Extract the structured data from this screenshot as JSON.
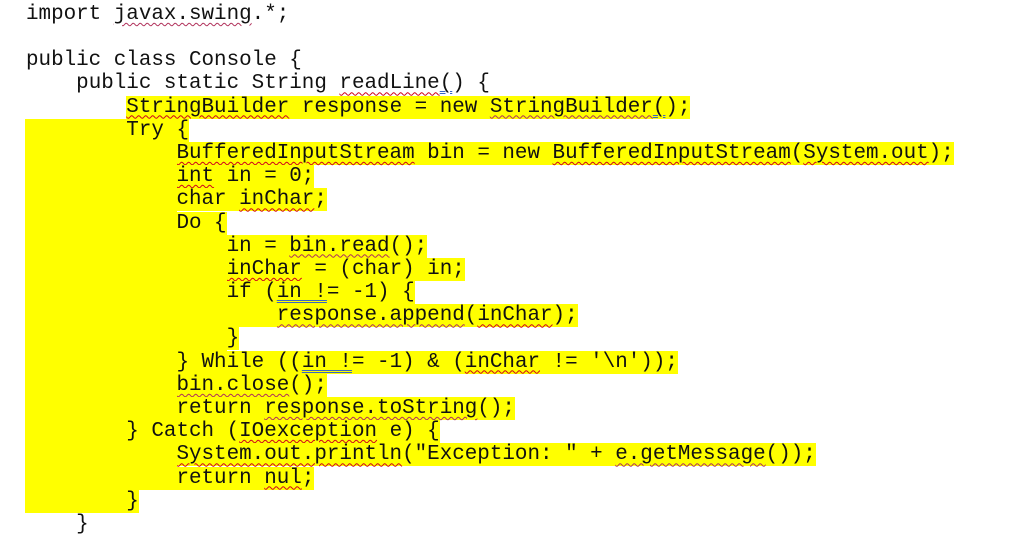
{
  "document": {
    "highlight_color": "#ffff00",
    "spell_underline_color": "#d0021b",
    "grammar_underline_color": "#3a66c4",
    "lines": [
      {
        "indent": 0,
        "hl": false,
        "fill": false,
        "segs": [
          {
            "t": "import "
          },
          {
            "t": "javax.swing",
            "u": "redblue"
          },
          {
            "t": ".*;"
          }
        ]
      },
      {
        "blank": true
      },
      {
        "indent": 0,
        "hl": false,
        "fill": false,
        "segs": [
          {
            "t": "public class Console {"
          }
        ]
      },
      {
        "indent": 4,
        "hl": false,
        "fill": false,
        "segs": [
          {
            "t": "public static String "
          },
          {
            "t": "readLine",
            "u": "red"
          },
          {
            "t": "(",
            "u": "blue"
          },
          {
            "t": ") {"
          }
        ]
      },
      {
        "indent": 8,
        "hl": true,
        "fill": false,
        "segs": [
          {
            "t": "StringBuilder",
            "u": "red"
          },
          {
            "t": " response = new "
          },
          {
            "t": "StringBuilder",
            "u": "redblue"
          },
          {
            "t": "(",
            "u": "blue"
          },
          {
            "t": ");"
          }
        ]
      },
      {
        "indent": 8,
        "hl": true,
        "fill": true,
        "segs": [
          {
            "t": "Try {"
          }
        ]
      },
      {
        "indent": 12,
        "hl": true,
        "fill": true,
        "segs": [
          {
            "t": "BufferedInputStream",
            "u": "red"
          },
          {
            "t": " bin = new "
          },
          {
            "t": "BufferedInputStream",
            "u": "red"
          },
          {
            "t": "("
          },
          {
            "t": "System.out",
            "u": "red"
          },
          {
            "t": ");"
          }
        ]
      },
      {
        "indent": 12,
        "hl": true,
        "fill": true,
        "segs": [
          {
            "t": "int",
            "u": "red"
          },
          {
            "t": " in = 0;"
          }
        ]
      },
      {
        "indent": 12,
        "hl": true,
        "fill": true,
        "segs": [
          {
            "t": "char "
          },
          {
            "t": "inChar",
            "u": "red"
          },
          {
            "t": ";"
          }
        ]
      },
      {
        "indent": 12,
        "hl": true,
        "fill": true,
        "segs": [
          {
            "t": "Do {"
          }
        ]
      },
      {
        "indent": 16,
        "hl": true,
        "fill": true,
        "segs": [
          {
            "t": "in = "
          },
          {
            "t": "bin.read",
            "u": "redblue"
          },
          {
            "t": "();"
          }
        ]
      },
      {
        "indent": 16,
        "hl": true,
        "fill": true,
        "segs": [
          {
            "t": "inChar",
            "u": "red"
          },
          {
            "t": " = (char) in;"
          }
        ]
      },
      {
        "indent": 16,
        "hl": true,
        "fill": true,
        "segs": [
          {
            "t": "if ("
          },
          {
            "t": "in !",
            "u": "blue"
          },
          {
            "t": "= -1) {"
          }
        ]
      },
      {
        "indent": 20,
        "hl": true,
        "fill": true,
        "segs": [
          {
            "t": "response.append",
            "u": "redblue"
          },
          {
            "t": "("
          },
          {
            "t": "inChar",
            "u": "red"
          },
          {
            "t": ");"
          }
        ]
      },
      {
        "indent": 16,
        "hl": true,
        "fill": true,
        "segs": [
          {
            "t": "}"
          }
        ]
      },
      {
        "indent": 12,
        "hl": true,
        "fill": true,
        "segs": [
          {
            "t": "} While (("
          },
          {
            "t": "in !",
            "u": "blue"
          },
          {
            "t": "= -1) & ("
          },
          {
            "t": "inChar",
            "u": "red"
          },
          {
            "t": " != '\\n'));"
          }
        ]
      },
      {
        "indent": 12,
        "hl": true,
        "fill": true,
        "segs": [
          {
            "t": "bin.close",
            "u": "redblue"
          },
          {
            "t": "();"
          }
        ]
      },
      {
        "indent": 12,
        "hl": true,
        "fill": true,
        "segs": [
          {
            "t": "return "
          },
          {
            "t": "response.toString",
            "u": "redblue"
          },
          {
            "t": "();"
          }
        ]
      },
      {
        "indent": 8,
        "hl": true,
        "fill": true,
        "segs": [
          {
            "t": "} Catch ("
          },
          {
            "t": "IOexception",
            "u": "red"
          },
          {
            "t": " e) {"
          }
        ]
      },
      {
        "indent": 12,
        "hl": true,
        "fill": true,
        "segs": [
          {
            "t": "System.out.println",
            "u": "red"
          },
          {
            "t": "(\"Exception: \" + "
          },
          {
            "t": "e.getMessage",
            "u": "redblue"
          },
          {
            "t": "());"
          }
        ]
      },
      {
        "indent": 12,
        "hl": true,
        "fill": true,
        "segs": [
          {
            "t": "return "
          },
          {
            "t": "nul",
            "u": "red"
          },
          {
            "t": ";"
          }
        ]
      },
      {
        "indent": 8,
        "hl": true,
        "fill": true,
        "segs": [
          {
            "t": "}"
          }
        ]
      },
      {
        "indent": 4,
        "hl": false,
        "fill": false,
        "segs": [
          {
            "t": "}"
          }
        ]
      }
    ]
  }
}
